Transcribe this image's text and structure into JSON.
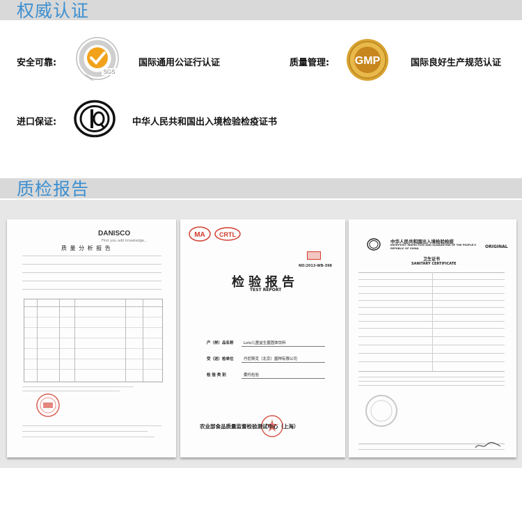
{
  "sections": {
    "authority": {
      "title": "权威认证"
    },
    "quality": {
      "title": "质检报告"
    }
  },
  "certs": [
    {
      "label": "安全可靠:",
      "logo_name": "sgs-iso-logo",
      "logo_ring_text": "ISO9001-2000",
      "logo_brand": "SGS",
      "desc": "国际通用公证行认证"
    },
    {
      "label": "质量管理:",
      "logo_name": "gmp-logo",
      "logo_brand": "GMP",
      "desc": "国际良好生产规范认证"
    },
    {
      "label": "进口保证:",
      "logo_name": "ciq-logo",
      "logo_brand": "CIQ",
      "desc": "中华人民共和国出入境检验检疫证书"
    }
  ],
  "documents": {
    "danisco": {
      "brand": "DANISCO",
      "tagline": "First you add knowledge...",
      "title": "质 量 分 析 报 告"
    },
    "test_report": {
      "logos": [
        "MA",
        "CRTL"
      ],
      "title": "检验报告",
      "subtitle": "TEST REPORT",
      "number": "NO:2013-WB-398",
      "fields": [
        {
          "label": "产（样）品名称",
          "value": "Lolo儿童益生菌固体饮料"
        },
        {
          "label": "受（送）检单位",
          "value": "丹尼斯克（北京）菌种有限公司"
        },
        {
          "label": "检 验 类 别",
          "value": "委托检验"
        }
      ],
      "issuer": "农业部食品质量监督检验测试中心（上海）"
    },
    "sanitary": {
      "header_cn": "中华人民共和国出入境检验检疫",
      "header_en": "ENTRY-EXIT INSPECTION AND QUARANTINE OF THE PEOPLE'S REPUBLIC OF CHINA",
      "original": "ORIGINAL",
      "title_cn": "卫生证书",
      "title_en": "SANITARY CERTIFICATE"
    }
  },
  "colors": {
    "accent_blue": "#3d8fd0",
    "bar_gray": "#d9d9d9",
    "stamp_red": "#d23b2d",
    "sgs_orange": "#f2a21a",
    "gmp_gold": "#d9a231"
  }
}
